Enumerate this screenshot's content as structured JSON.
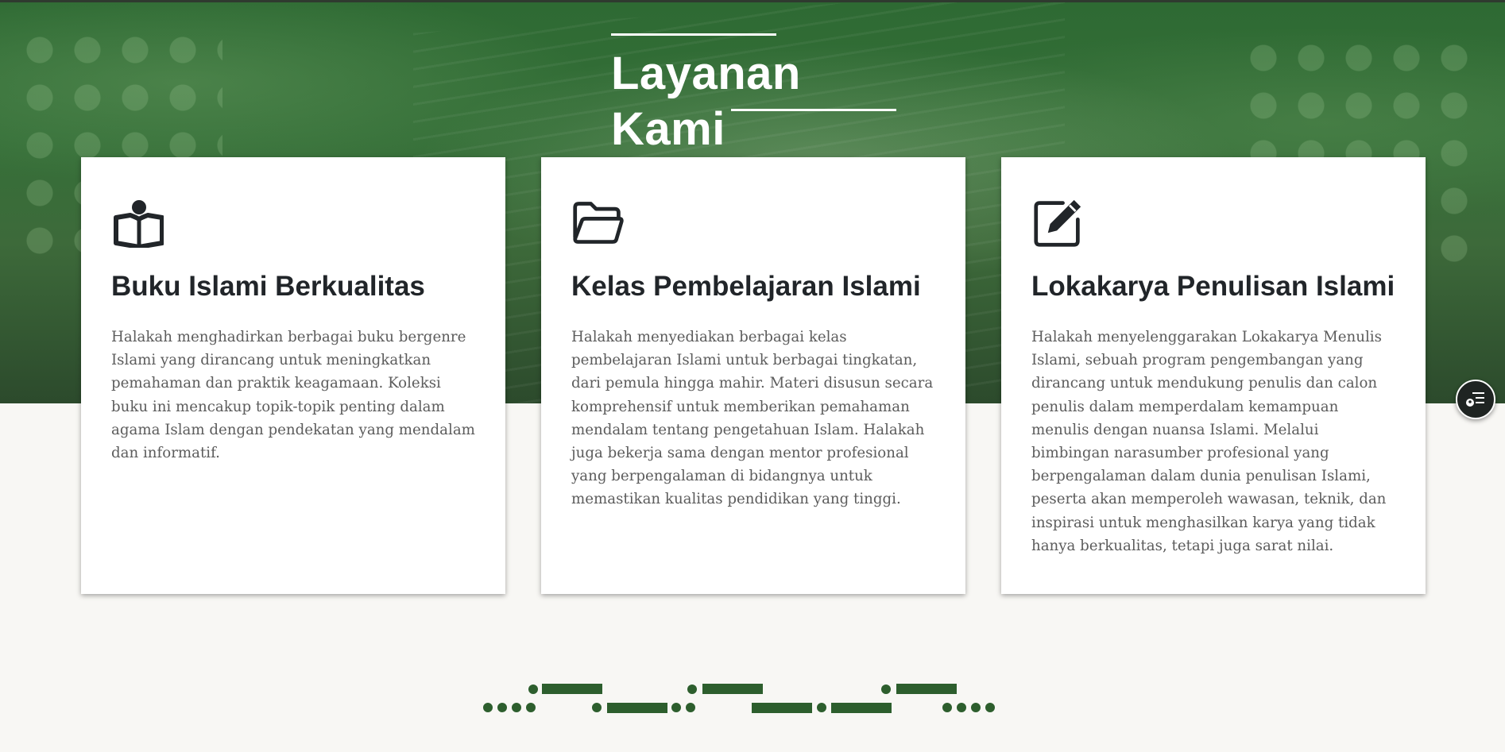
{
  "section": {
    "title": "Layanan Kami"
  },
  "cards": [
    {
      "icon": "book-reader-icon",
      "title": "Buku Islami Berkualitas",
      "description": "Halakah menghadirkan berbagai buku bergenre Islami yang dirancang untuk meningkatkan pemahaman dan praktik keagamaan. Koleksi buku ini mencakup topik-topik penting dalam agama Islam dengan pendekatan yang mendalam dan informatif."
    },
    {
      "icon": "folder-open-icon",
      "title": "Kelas Pembelajaran Islami",
      "description": "Halakah menyediakan berbagai kelas pembelajaran Islami untuk berbagai tingkatan, dari pemula hingga mahir. Materi disusun secara komprehensif untuk memberikan pemahaman mendalam tentang pengetahuan Islam. Halakah juga bekerja sama dengan mentor profesional yang berpengalaman di bidangnya untuk memastikan kualitas pendidikan yang tinggi."
    },
    {
      "icon": "edit-icon",
      "title": "Lokakarya Penulisan Islami",
      "description": "Halakah menyelenggarakan Lokakarya Menulis Islami, sebuah program pengembangan yang dirancang untuk mendukung penulis dan calon penulis dalam memperdalam kemampuan menulis dengan nuansa Islami. Melalui bimbingan narasumber profesional yang berpengalaman dalam dunia penulisan Islami, peserta akan memperoleh wawasan, teknik, dan inspirasi untuk menghasilkan karya yang tidak hanya berkualitas, tetapi juga sarat nilai."
    }
  ],
  "floating_button": {
    "icon": "user-list-icon"
  },
  "colors": {
    "brand_green": "#2e6a33",
    "ornament_green": "#2d5e2d",
    "card_bg": "#ffffff",
    "page_bg": "#f8f7f4"
  }
}
